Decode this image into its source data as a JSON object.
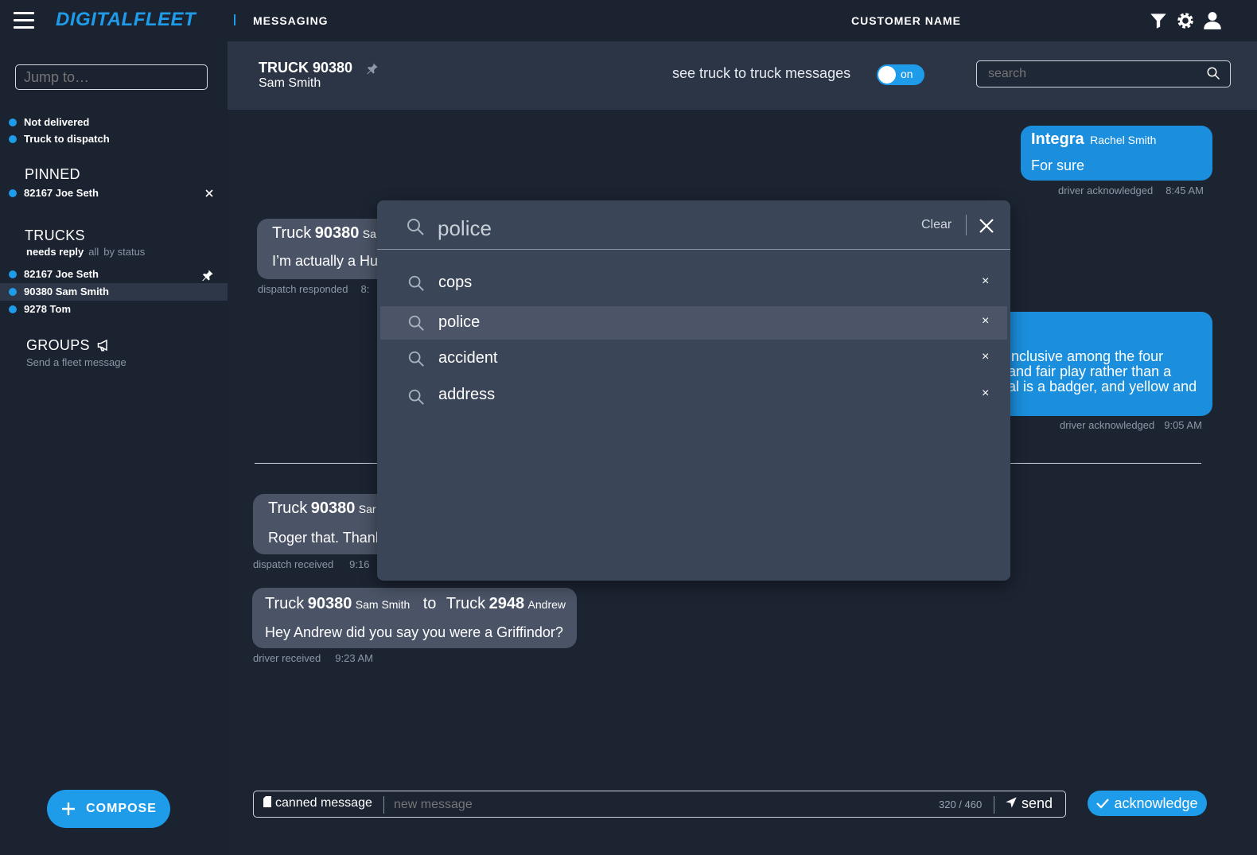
{
  "topbar": {
    "brand": "DIGITALFLEET",
    "module": "MESSAGING",
    "customer": "CUSTOMER NAME"
  },
  "sidebar": {
    "jump_placeholder": "Jump to…",
    "legend": [
      "Not delivered",
      "Truck to dispatch"
    ],
    "pinned_title": "PINNED",
    "pinned": [
      {
        "label": "82167 Joe Seth"
      }
    ],
    "trucks_title": "TRUCKS",
    "filters": {
      "needs_reply": "needs reply",
      "all": "all",
      "by_status": "by status"
    },
    "trucks": [
      {
        "label": "82167 Joe Seth"
      },
      {
        "label": "90380 Sam Smith"
      },
      {
        "label": "9278 Tom"
      }
    ],
    "groups_title": "GROUPS",
    "groups_sub": "Send a fleet message",
    "compose": "COMPOSE"
  },
  "header": {
    "truck": "TRUCK 90380",
    "driver": "Sam Smith",
    "t2t_label": "see truck to truck messages",
    "toggle": "on",
    "search_placeholder": "search"
  },
  "messages": [
    {
      "sender": "Integra",
      "sender_sub": "Rachel Smith",
      "text": "For sure",
      "status": "driver acknowledged",
      "time": "8:45 AM"
    },
    {
      "prefix": "Truck",
      "sender": "90380",
      "sender_sub": "Sa",
      "text": "I’m actually a Hu",
      "status": "dispatch responded",
      "time": "8:"
    },
    {
      "lines": [
        "inclusive among the four",
        "and fair play rather than a",
        "al is a badger, and yellow and"
      ],
      "status": "driver acknowledged",
      "time": "9:05 AM"
    },
    {
      "prefix": "Truck",
      "sender": "90380",
      "sender_sub": "Sar",
      "text": "Roger that. Thanl",
      "status": "dispatch received",
      "time": "9:16"
    },
    {
      "prefix": "Truck",
      "sender": "90380",
      "sender_sub": "Sam Smith",
      "to": "to",
      "prefix2": "Truck",
      "sender2": "2948",
      "sender2_sub": "Andrew",
      "text": "Hey Andrew did you say you were a Griffindor?",
      "status": "driver received",
      "time": "9:23 AM"
    }
  ],
  "search_overlay": {
    "query": "police",
    "clear": "Clear",
    "results": [
      {
        "label": "cops"
      },
      {
        "label": "police"
      },
      {
        "label": "accident"
      },
      {
        "label": "address"
      }
    ],
    "highlighted": "police"
  },
  "composer": {
    "canned": "canned message",
    "placeholder": "new message",
    "count": "320 / 460",
    "send": "send",
    "acknowledge": "acknowledge"
  },
  "colors": {
    "accent": "#1e9be9",
    "background": "#1c2432",
    "panel": "#2b3545",
    "incoming_bubble": "#4a5466",
    "outgoing_bubble": "#1b8fdd"
  }
}
